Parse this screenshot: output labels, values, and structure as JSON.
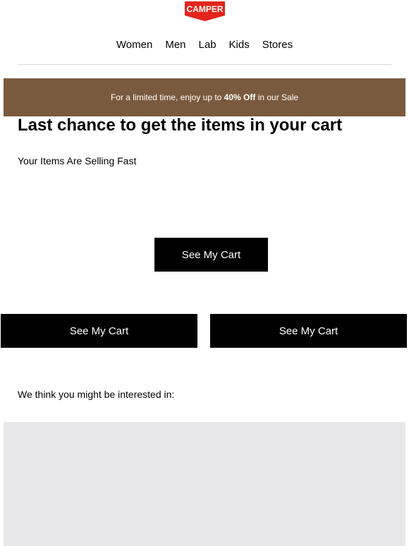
{
  "brand": {
    "logo_text": "CAMPER",
    "logo_color": "#e3251b"
  },
  "nav": {
    "items": [
      "Women",
      "Men",
      "Lab",
      "Kids",
      "Stores"
    ]
  },
  "promo": {
    "before": "For a limited time, enjoy up to ",
    "bold": "40% Off",
    "after": " in our Sale",
    "background": "#7a5a3e"
  },
  "headline": "Last chance to get the items in your cart",
  "subline": "Your Items Are Selling Fast",
  "buttons": {
    "main": "See My Cart",
    "left": "See My Cart",
    "right": "See My Cart"
  },
  "recommendations": {
    "heading": "We think you might be interested in:"
  }
}
